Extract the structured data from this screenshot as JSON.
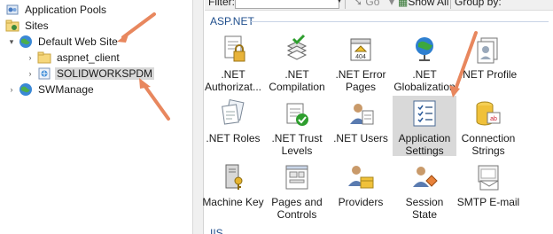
{
  "tree": {
    "items": [
      {
        "label": "Application Pools",
        "icon": "app-pools-icon",
        "expander": ""
      },
      {
        "label": "Sites",
        "icon": "sites-folder-icon",
        "expander": ""
      },
      {
        "label": "Default Web Site",
        "icon": "globe-icon",
        "expander": "▾"
      },
      {
        "label": "aspnet_client",
        "icon": "folder-icon",
        "expander": "›"
      },
      {
        "label": "SOLIDWORKSPDM",
        "icon": "web-app-icon",
        "expander": "›"
      },
      {
        "label": "SWManage",
        "icon": "globe-icon",
        "expander": "›"
      }
    ]
  },
  "toolbar": {
    "filter_label": "Filter:",
    "go_label": "Go",
    "show_all_label": "Show All",
    "group_by_label": "Group by:"
  },
  "group": {
    "title": "ASP.NET",
    "next_title": "IIS"
  },
  "features": [
    {
      "label": ".NET\nAuthorizat...",
      "icon": "lock-document-icon"
    },
    {
      "label": ".NET\nCompilation",
      "icon": "compilation-icon"
    },
    {
      "label": ".NET Error\nPages",
      "icon": "error-404-icon"
    },
    {
      "label": ".NET\nGlobalization",
      "icon": "globe-stand-icon"
    },
    {
      "label": ".NET Profile",
      "icon": "profile-icon"
    },
    {
      "label": ".NET Roles",
      "icon": "roles-icon"
    },
    {
      "label": ".NET Trust\nLevels",
      "icon": "trust-check-icon"
    },
    {
      "label": ".NET Users",
      "icon": "users-icon"
    },
    {
      "label": "Application\nSettings",
      "icon": "settings-list-icon"
    },
    {
      "label": "Connection\nStrings",
      "icon": "database-icon"
    },
    {
      "label": "Machine Key",
      "icon": "machine-key-icon"
    },
    {
      "label": "Pages and\nControls",
      "icon": "pages-controls-icon"
    },
    {
      "label": "Providers",
      "icon": "providers-icon"
    },
    {
      "label": "Session State",
      "icon": "session-state-icon"
    },
    {
      "label": "SMTP E-mail",
      "icon": "smtp-email-icon"
    }
  ],
  "colors": {
    "arrow": "#e8875e",
    "group_heading": "#1f4e8c",
    "selection": "#d9d9d9"
  }
}
